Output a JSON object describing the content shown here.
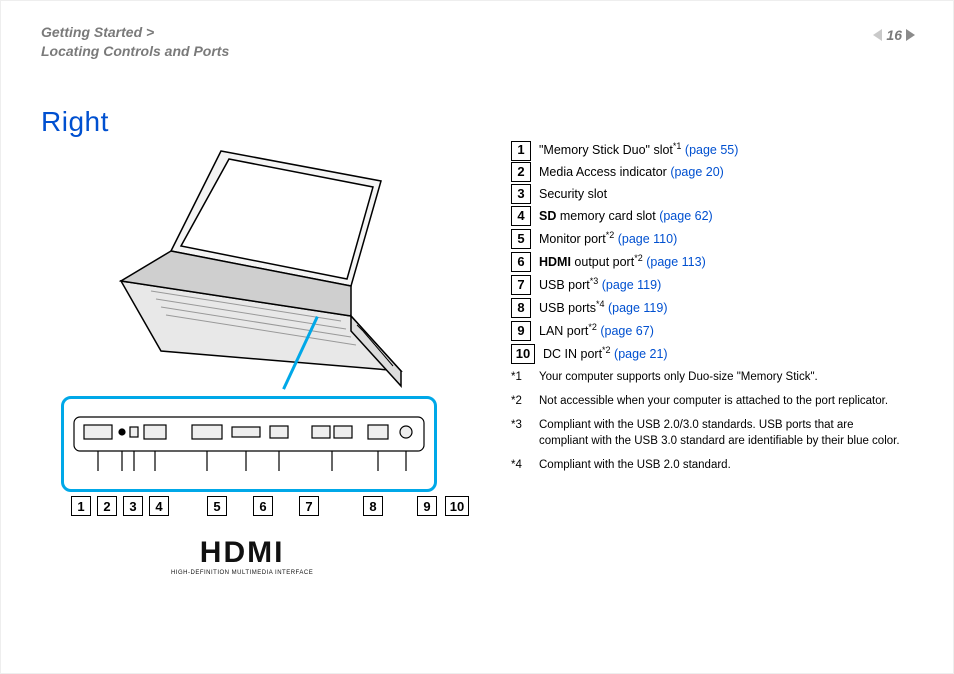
{
  "breadcrumb_line1": "Getting Started >",
  "breadcrumb_line2": "Locating Controls and Ports",
  "page_number": "16",
  "section_title": "Right",
  "numbers": [
    "1",
    "2",
    "3",
    "4",
    "5",
    "6",
    "7",
    "8",
    "9",
    "10"
  ],
  "items": [
    {
      "num": "1",
      "pre": "\"Memory Stick Duo\" slot",
      "sup": "*1",
      "link": "(page 55)"
    },
    {
      "num": "2",
      "pre": "Media Access indicator ",
      "sup": "",
      "link": "(page 20)"
    },
    {
      "num": "3",
      "pre": "Security slot",
      "sup": "",
      "link": ""
    },
    {
      "num": "4",
      "bold": "SD",
      "pre": " memory card slot ",
      "sup": "",
      "link": "(page 62)"
    },
    {
      "num": "5",
      "pre": "Monitor port",
      "sup": "*2",
      "link": "(page 110)"
    },
    {
      "num": "6",
      "bold": "HDMI",
      "pre": " output port",
      "sup": "*2",
      "link": "(page 113)"
    },
    {
      "num": "7",
      "pre": "USB port",
      "sup": "*3",
      "link": "(page 119)"
    },
    {
      "num": "8",
      "pre": "USB ports",
      "sup": "*4",
      "link": "(page 119)"
    },
    {
      "num": "9",
      "pre": "LAN port",
      "sup": "*2",
      "link": "(page 67)"
    },
    {
      "num": "10",
      "pre": "DC IN port",
      "sup": "*2",
      "link": "(page 21)"
    }
  ],
  "footnotes": [
    {
      "marker": "*1",
      "text": "Your computer supports only Duo-size \"Memory Stick\"."
    },
    {
      "marker": "*2",
      "text": "Not accessible when your computer is attached to the port replicator."
    },
    {
      "marker": "*3",
      "text": "Compliant with the USB 2.0/3.0 standards. USB ports that are compliant with the USB 3.0 standard are identifiable by their blue color."
    },
    {
      "marker": "*4",
      "text": "Compliant with the USB 2.0 standard."
    }
  ],
  "hdmi_big": "HDMI",
  "hdmi_small": "HIGH-DEFINITION MULTIMEDIA INTERFACE"
}
